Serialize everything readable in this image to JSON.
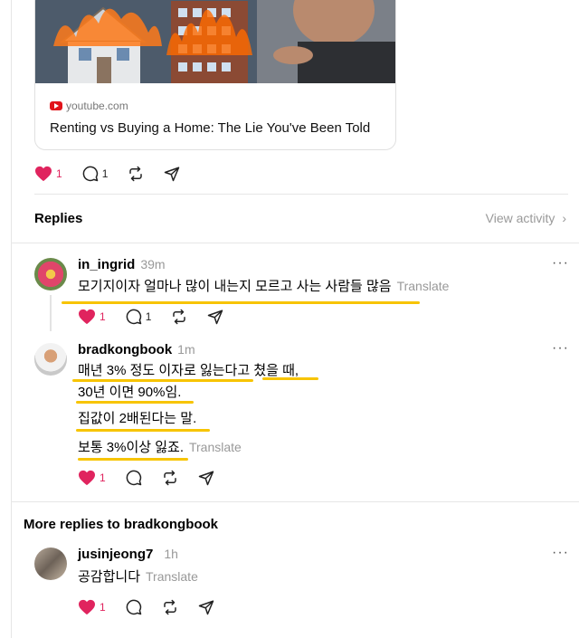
{
  "link_card": {
    "source": "youtube.com",
    "title": "Renting vs Buying a Home: The Lie You've Been Told"
  },
  "post_actions": {
    "likes": "1",
    "replies": "1"
  },
  "replies_header": {
    "title": "Replies",
    "view_activity": "View activity"
  },
  "replies": [
    {
      "username": "in_ingrid",
      "time": "39m",
      "lines": [
        "모기지이자 얼마나 많이 내는지 모르고 사는 사람들 많음"
      ],
      "translate": "Translate",
      "likes": "1",
      "replies": "1"
    },
    {
      "username": "bradkongbook",
      "time": "1m",
      "lines": [
        "매년 3% 정도 이자로 잃는다고 쳤을 때,",
        "30년 이면 90%임.",
        "집값이 2배된다는 말.",
        "보통 3%이상 잃죠."
      ],
      "translate": "Translate",
      "likes": "1"
    }
  ],
  "more_replies_title": "More replies to bradkongbook",
  "nested_reply": {
    "username": "jusinjeong7",
    "time": "1h",
    "text": "공감합니다",
    "translate": "Translate",
    "likes": "1"
  },
  "colors": {
    "like": "#e0245e",
    "highlight": "#f7c400",
    "muted": "#999999"
  }
}
